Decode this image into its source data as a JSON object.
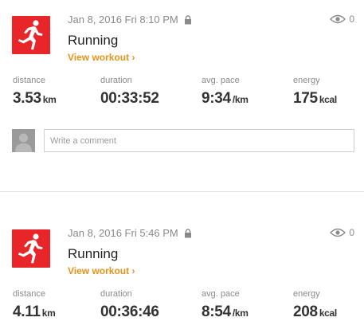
{
  "feed": {
    "workouts": [
      {
        "date": "Jan 8, 2016 Fri 8:10 PM",
        "views": "0",
        "activity": "Running",
        "view_link": "View workout ›",
        "stats": {
          "distance": {
            "label": "distance",
            "value": "3.53",
            "unit": "km"
          },
          "duration": {
            "label": "duration",
            "value": "00:33:52",
            "unit": ""
          },
          "pace": {
            "label": "avg. pace",
            "value": "9:34",
            "unit": "/km"
          },
          "energy": {
            "label": "energy",
            "value": "175",
            "unit": "kcal"
          }
        },
        "comment_placeholder": "Write a comment"
      },
      {
        "date": "Jan 8, 2016 Fri 5:46 PM",
        "views": "0",
        "activity": "Running",
        "view_link": "View workout ›",
        "stats": {
          "distance": {
            "label": "distance",
            "value": "4.11",
            "unit": "km"
          },
          "duration": {
            "label": "duration",
            "value": "00:36:46",
            "unit": ""
          },
          "pace": {
            "label": "avg. pace",
            "value": "8:54",
            "unit": "/km"
          },
          "energy": {
            "label": "energy",
            "value": "208",
            "unit": "kcal"
          }
        }
      }
    ]
  },
  "icons": {
    "sport": "running-person-icon",
    "lock": "lock-icon",
    "views": "eye-icon",
    "avatar": "default-avatar-icon"
  },
  "colors": {
    "sport_icon_bg": "#e8262a",
    "link": "#e9921a",
    "muted_text": "#8a8a8a",
    "value_text": "#333333"
  }
}
